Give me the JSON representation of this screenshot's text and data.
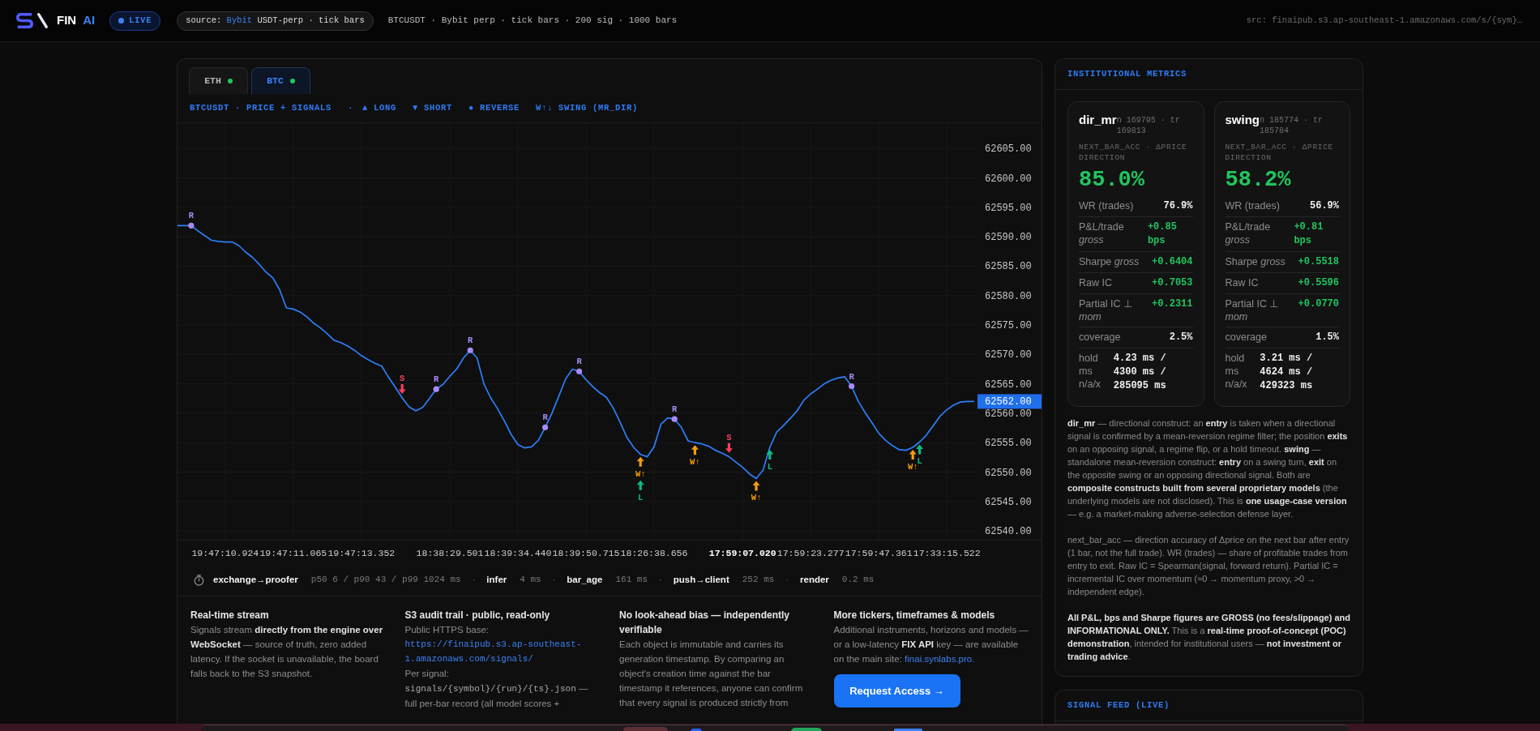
{
  "header": {
    "brand": {
      "name": "FIN",
      "accent": "AI"
    },
    "live_badge": "LIVE",
    "source": {
      "prefix": "source:",
      "venue": "Bybit",
      "suffix": "USDT-perp · tick bars"
    },
    "info": "BTCUSDT · Bybit perp · tick bars · 200 sig · 1000 bars",
    "src": "src: finaipub.s3.ap-southeast-1.amazonaws.com/s/{sym}…"
  },
  "chart": {
    "tabs": [
      {
        "label": "ETH",
        "selected": false
      },
      {
        "label": "BTC",
        "selected": true
      }
    ],
    "legend": [
      {
        "kind": "separator",
        "text": "·"
      },
      {
        "kind": "item",
        "text": "▲ LONG"
      },
      {
        "kind": "item",
        "text": "▼ SHORT"
      },
      {
        "kind": "item",
        "text": "● REVERSE"
      },
      {
        "kind": "item",
        "text": "W↑↓ SWING (MR_DIR)"
      }
    ],
    "chart_data": {
      "type": "line",
      "title": "BTCUSDT · PRICE + SIGNALS",
      "grid": true,
      "ylim": [
        62538.5,
        62609.3
      ],
      "categories": [
        null,
        null,
        null,
        null,
        null,
        null,
        null,
        "19:47:10.924",
        null,
        null,
        null,
        null,
        null,
        null,
        null,
        null,
        null,
        "19:47:11.065",
        null,
        null,
        null,
        null,
        null,
        null,
        null,
        null,
        null,
        "19:47:13.352",
        null,
        null,
        null,
        null,
        null,
        null,
        null,
        null,
        null,
        null,
        null,
        null,
        "18:38:29.501",
        null,
        null,
        null,
        null,
        null,
        null,
        null,
        null,
        null,
        "18:39:34.440",
        null,
        null,
        null,
        null,
        null,
        null,
        null,
        null,
        null,
        "18:39:50.715",
        null,
        null,
        null,
        null,
        null,
        null,
        null,
        null,
        null,
        "18:26:38.656",
        null,
        null,
        null,
        null,
        null,
        null,
        null,
        null,
        null,
        null,
        null,
        null,
        "17:59:07.020",
        null,
        null,
        null,
        null,
        null,
        null,
        null,
        null,
        null,
        "17:59:23.277",
        null,
        null,
        null,
        null,
        null,
        null,
        null,
        null,
        null,
        "17:59:47.361",
        null,
        null,
        null,
        null,
        null,
        null,
        null,
        null,
        null,
        "17:33:15.522",
        null,
        null,
        null,
        null
      ],
      "series": [
        {
          "color": "#2d7ff9",
          "values": [
            62591.9,
            62591.9,
            62591.9,
            62591.0,
            62590.2,
            62589.4,
            62589.2,
            62589.1,
            62589.1,
            62588.5,
            62587.4,
            62586.5,
            62585.3,
            62584.0,
            62583.0,
            62581.0,
            62577.9,
            62577.7,
            62577.2,
            62576.4,
            62575.3,
            62574.5,
            62573.5,
            62572.4,
            62572.0,
            62571.4,
            62570.7,
            62569.8,
            62569.1,
            62568.5,
            62568.0,
            62566.1,
            62564.4,
            62562.6,
            62561.1,
            62560.4,
            62561.0,
            62562.5,
            62564.1,
            62564.9,
            62566.3,
            62567.5,
            62569.4,
            62570.7,
            62569.4,
            62565.0,
            62562.6,
            62560.8,
            62558.7,
            62556.4,
            62554.7,
            62554.1,
            62554.3,
            62555.4,
            62557.6,
            62560.0,
            62562.9,
            62565.8,
            62567.5,
            62567.1,
            62565.7,
            62564.5,
            62563.5,
            62562.7,
            62560.9,
            62558.5,
            62555.9,
            62554.2,
            62553.0,
            62552.6,
            62554.3,
            62558.1,
            62559.2,
            62559.0,
            62557.6,
            62555.3,
            62555.0,
            62554.8,
            62554.4,
            62553.7,
            62553.2,
            62552.6,
            62551.7,
            62550.8,
            62549.7,
            62548.9,
            62550.3,
            62554.2,
            62556.8,
            62557.9,
            62559.1,
            62560.4,
            62562.2,
            62563.3,
            62564.1,
            62565.0,
            62565.6,
            62566.0,
            62566.2,
            62564.6,
            62562.0,
            62560.1,
            62558.4,
            62556.6,
            62555.4,
            62554.5,
            62553.8,
            62553.7,
            62554.2,
            62555.1,
            62556.3,
            62557.9,
            62559.5,
            62560.6,
            62561.4,
            62561.9,
            62562.0,
            62562.0
          ]
        }
      ],
      "yticks": [
        {
          "value": 62540,
          "label": "62540.00"
        },
        {
          "value": 62545,
          "label": "62545.00"
        },
        {
          "value": 62550,
          "label": "62550.00"
        },
        {
          "value": 62555,
          "label": "62555.00"
        },
        {
          "value": 62560,
          "label": "62560.00"
        },
        {
          "value": 62565,
          "label": "62565.00"
        },
        {
          "value": 62570,
          "label": "62570.00"
        },
        {
          "value": 62575,
          "label": "62575.00"
        },
        {
          "value": 62580,
          "label": "62580.00"
        },
        {
          "value": 62585,
          "label": "62585.00"
        },
        {
          "value": 62590,
          "label": "62590.00"
        },
        {
          "value": 62595,
          "label": "62595.00"
        },
        {
          "value": 62600,
          "label": "62600.00"
        },
        {
          "value": 62605,
          "label": "62605.00"
        }
      ],
      "annotations": [
        "R",
        "S",
        "R",
        "R",
        "R",
        "R",
        "W↑",
        "L",
        "R",
        "W↑",
        "S",
        "W↑",
        "L",
        "R",
        "W↑",
        "L"
      ]
    },
    "signals": [
      {
        "kind": "reverse",
        "color": "#a78bfa"
      },
      {
        "kind": "short",
        "color": "#f43f5e"
      },
      {
        "kind": "reverse",
        "color": "#a78bfa"
      },
      {
        "kind": "reverse",
        "color": "#a78bfa"
      },
      {
        "kind": "reverse",
        "color": "#a78bfa"
      },
      {
        "kind": "reverse",
        "color": "#a78bfa"
      },
      {
        "kind": "swing",
        "color": "#f59e0b"
      },
      {
        "kind": "long",
        "color": "#10b981"
      },
      {
        "kind": "reverse",
        "color": "#a78bfa"
      },
      {
        "kind": "swing",
        "color": "#f59e0b"
      },
      {
        "kind": "short",
        "color": "#f43f5e"
      },
      {
        "kind": "swing",
        "color": "#f59e0b"
      },
      {
        "kind": "long",
        "color": "#10b981"
      },
      {
        "kind": "reverse",
        "color": "#a78bfa"
      },
      {
        "kind": "swing",
        "color": "#f59e0b"
      },
      {
        "kind": "long",
        "color": "#10b981"
      }
    ],
    "time_label_emphasis": [
      false,
      false,
      false,
      false,
      false,
      false,
      false,
      true,
      false,
      false,
      false
    ],
    "price_tag": "62562.00",
    "latency": [
      {
        "label": "exchange→proofer",
        "value": "p50 6 / p90 43 / p99 1024 ms",
        "separator": "·"
      },
      {
        "label": "infer",
        "value": "4 ms",
        "separator": "·"
      },
      {
        "label": "bar_age",
        "value": "161 ms",
        "separator": "·"
      },
      {
        "label": "push→client",
        "value": "252 ms",
        "separator": "·"
      },
      {
        "label": "render",
        "value": "0.2 ms"
      }
    ]
  },
  "footer_columns": [
    {
      "title": "Real-time stream",
      "blocks": [
        {
          "kind": "text",
          "text": "Signals stream **directly from the engine over WebSocket** — source of truth, zero added latency. If the socket is unavailable, the board falls back to the S3 snapshot."
        }
      ]
    },
    {
      "title": "S3 audit trail · public, read-only",
      "blocks": [
        {
          "kind": "text",
          "text": "Public HTTPS base:"
        },
        {
          "kind": "link",
          "text": "https://finaipub.s3.ap-southeast-1.amazonaws.com/signals/"
        },
        {
          "kind": "text",
          "text": "Per signal:"
        },
        {
          "kind": "code",
          "code": "signals/{symbol}/{run}/{ts}.json",
          "text": "— full per-bar record (all model scores +"
        }
      ]
    },
    {
      "title": "No look-ahead bias — independently verifiable",
      "blocks": [
        {
          "kind": "text",
          "text": "Each object is immutable and carries its generation timestamp. By comparing an object's creation time against the bar timestamp it references, anyone can confirm that every signal is produced strictly from"
        }
      ]
    },
    {
      "title": "More tickers, timeframes & models",
      "blocks": [
        {
          "kind": "text",
          "text": "Additional instruments, horizons and models — or a low-latency **FIX API** key — are available on the main site:",
          "link": "finai.synlabs.pro."
        },
        {
          "kind": "button",
          "text": "Request Access →"
        }
      ]
    }
  ],
  "metrics": {
    "title": "INSTITUTIONAL METRICS",
    "cards": [
      {
        "name": "dir_mr",
        "meta": "n 169795 · tr 169813",
        "subtitle": "NEXT_BAR_ACC · ΔPRICE DIRECTION",
        "headline": "85.0%",
        "rows": [
          {
            "label": "WR (trades)",
            "value": "76.9%",
            "positive": false
          },
          {
            "label": "P&L/trade *gross*",
            "value": "+0.85 bps",
            "positive": true
          },
          {
            "label": "Sharpe *gross*",
            "value": "+0.6404",
            "positive": true
          },
          {
            "label": "Raw IC",
            "value": "+0.7053",
            "positive": true
          },
          {
            "label": "Partial IC ⊥ *mom*",
            "value": "+0.2311",
            "positive": true
          },
          {
            "label": "coverage",
            "value": "2.5%",
            "positive": false
          },
          {
            "label": "hold ms n/a/x",
            "value": "4.23 ms / 4300 ms / 285095 ms",
            "positive": false
          }
        ]
      },
      {
        "name": "swing",
        "meta": "n 185774 · tr 185784",
        "subtitle": "NEXT_BAR_ACC · ΔPRICE DIRECTION",
        "headline": "58.2%",
        "rows": [
          {
            "label": "WR (trades)",
            "value": "56.9%",
            "positive": false
          },
          {
            "label": "P&L/trade *gross*",
            "value": "+0.81 bps",
            "positive": true
          },
          {
            "label": "Sharpe *gross*",
            "value": "+0.5518",
            "positive": true
          },
          {
            "label": "Raw IC",
            "value": "+0.5596",
            "positive": true
          },
          {
            "label": "Partial IC ⊥ *mom*",
            "value": "+0.0770",
            "positive": true
          },
          {
            "label": "coverage",
            "value": "1.5%",
            "positive": false
          },
          {
            "label": "hold ms n/a/x",
            "value": "3.21 ms / 4624 ms / 429323 ms",
            "positive": false
          }
        ]
      }
    ],
    "notes": [
      "**dir_mr** — directional construct: an **entry** is taken when a directional signal is confirmed by a mean-reversion regime filter; the position **exits** on an opposing signal, a regime flip, or a hold timeout. **swing** — standalone mean-reversion construct: **entry** on a swing turn, **exit** on the opposite swing or an opposing directional signal. Both are **composite constructs built from several proprietary models** (the underlying models are not disclosed). This is **one usage-case version** — e.g. a market-making adverse-selection defense layer.",
      "next_bar_acc — direction accuracy of Δprice on the next bar after entry (1 bar, not the full trade). WR (trades) — share of profitable trades from entry to exit. Raw IC = Spearman(signal, forward return). Partial IC = incremental IC over momentum (≈0 → momentum proxy, >0 → independent edge).",
      "**All P&L, bps and Sharpe figures are GROSS (no fees/slippage) and INFORMATIONAL ONLY.** This is a **real-time proof-of-concept (POC) demonstration**, intended for institutional users — **not investment or trading advice**."
    ]
  },
  "signal_feed": {
    "title": "SIGNAL FEED (LIVE)"
  }
}
